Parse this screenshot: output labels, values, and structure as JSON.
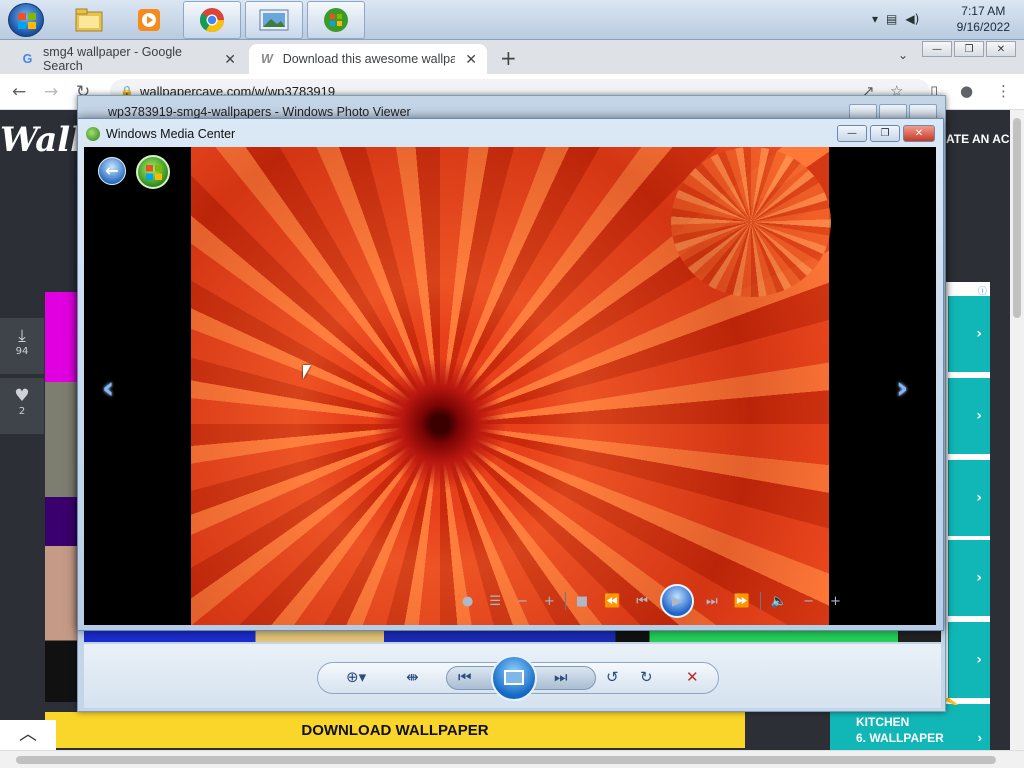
{
  "taskbar": {
    "apps": [
      "windows-explorer",
      "media-player",
      "google-chrome",
      "photo-viewer",
      "windows-media-center"
    ],
    "tray": {
      "time": "7:17 AM",
      "date": "9/16/2022"
    }
  },
  "browser": {
    "tabs": [
      {
        "favicon": "G",
        "title": "smg4 wallpaper - Google Search"
      },
      {
        "favicon": "W",
        "title": "Download this awesome wallpape"
      }
    ],
    "address": "wallpapercave.com/w/wp3783919"
  },
  "page": {
    "logo": "Wallpa",
    "create_account": "ATE AN ACC",
    "downloads_count": "94",
    "likes_count": "2",
    "download_label": "DOWNLOAD WALLPAPER",
    "kitchen_line1": "KITCHEN",
    "kitchen_line2": "6. WALLPAPER"
  },
  "photo_viewer": {
    "title": "wp3783919-smg4-wallpapers - Windows Photo Viewer"
  },
  "media_center": {
    "title": "Windows Media Center"
  },
  "colors": {
    "accent_teal": "#11b7b7",
    "download_yellow": "#fad52a",
    "close_red": "#c4392a"
  }
}
